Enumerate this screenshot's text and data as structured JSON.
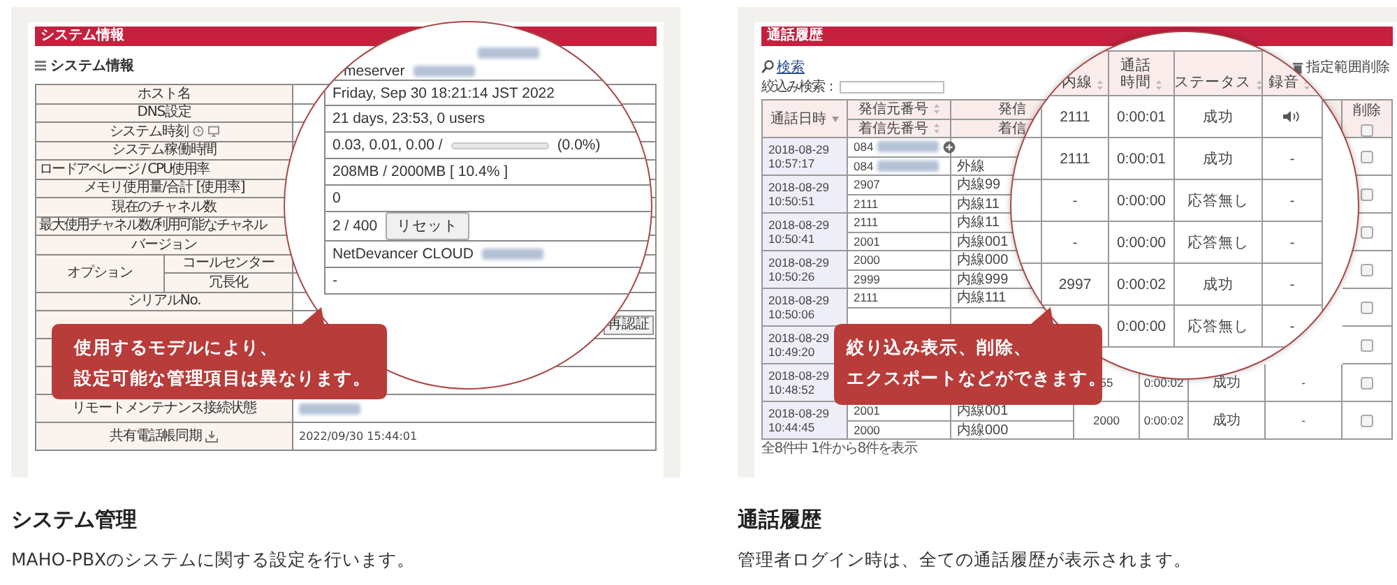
{
  "system_screenshot": {
    "header_bar": "システム情報",
    "subheading": "システム情報",
    "rows": [
      {
        "label": "ホスト名",
        "kind": "plain"
      },
      {
        "label": "DNS設定",
        "kind": "plain"
      },
      {
        "label": "システム時刻",
        "kind": "clock"
      },
      {
        "label": "システム稼働時間",
        "kind": "plain"
      },
      {
        "label": "ロードアベレージ / CPU使用率",
        "kind": "plain"
      },
      {
        "label": "メモリ使用量/合計 [使用率]",
        "kind": "plain"
      },
      {
        "label": "現在のチャネル数",
        "kind": "plain"
      },
      {
        "label": "最大使用チャネル数/利用可能なチャネル",
        "kind": "plain"
      },
      {
        "label": "バージョン",
        "kind": "plain"
      },
      {
        "label": "オプション",
        "kind": "option",
        "sublabels": [
          "コールセンター",
          "冗長化"
        ]
      },
      {
        "label": "シリアルNo.",
        "kind": "plain"
      }
    ],
    "lower_rows": [
      {
        "value": {
          "kind": "button",
          "text": "再認証"
        }
      },
      {},
      {},
      {
        "label": "リモートメンテナンス接続状態",
        "kind": "plain",
        "value": {
          "kind": "redacted"
        }
      },
      {
        "label": "共有電話帳同期",
        "kind": "sync",
        "value": {
          "kind": "text",
          "text": "2022/09/30 15:44:01"
        }
      }
    ],
    "magnifier": {
      "heading_rows": [
        [
          {
            "kind": "redacted"
          }
        ],
        [
          {
            "kind": "text",
            "text": "meserver"
          },
          {
            "kind": "redacted"
          }
        ]
      ],
      "rows": [
        [
          {
            "kind": "text",
            "text": "Friday, Sep 30 18:21:14 JST 2022"
          }
        ],
        [
          {
            "kind": "text",
            "text": "21 days, 23:53, 0 users"
          }
        ],
        [
          {
            "kind": "text",
            "text": "0.03, 0.01, 0.00 /"
          },
          {
            "kind": "meter",
            "level": 0
          },
          {
            "kind": "text",
            "text": "(0.0%)"
          }
        ],
        [
          {
            "kind": "text",
            "text": "208MB / 2000MB [ 10.4% ]"
          }
        ],
        [
          {
            "kind": "text",
            "text": "0"
          }
        ],
        [
          {
            "kind": "text",
            "text": "2 / 400"
          },
          {
            "kind": "button",
            "text": "リセット"
          }
        ],
        [
          {
            "kind": "text",
            "text": "NetDevancer CLOUD"
          },
          {
            "kind": "redacted"
          }
        ],
        [
          {
            "kind": "text",
            "text": "-"
          }
        ]
      ]
    },
    "callout": [
      "使用するモデルにより、",
      "設定可能な管理項目は異なります。"
    ]
  },
  "history_screenshot": {
    "header_bar": "通話履歴",
    "search_link": "検索",
    "filter_label": "絞込み検索：",
    "delete_range": "指定範囲削除",
    "headers": {
      "date": "通話日時",
      "from": "発信元番号",
      "to": "着信先番号",
      "column_3_top": "発信",
      "column_3_bottom": "着信",
      "delete": "削除",
      "delete_all_checked": false
    },
    "groups": [
      {
        "date": "2018-08-29",
        "time": "10:57:17",
        "checked": false,
        "lines": [
          {
            "number": "084",
            "redacted": true,
            "expandable": true
          },
          {
            "number": "084",
            "redacted": true,
            "expandable": false,
            "line": "外線"
          }
        ]
      },
      {
        "date": "2018-08-29",
        "time": "10:50:51",
        "checked": false,
        "lines": [
          {
            "number": "2907",
            "redacted": false,
            "expandable": false,
            "line": "内線99"
          },
          {
            "number": "2111",
            "redacted": false,
            "expandable": false,
            "line": "内線11"
          }
        ]
      },
      {
        "date": "2018-08-29",
        "time": "10:50:41",
        "checked": false,
        "lines": [
          {
            "number": "2111",
            "redacted": false,
            "expandable": false,
            "line": "内線11"
          },
          {
            "number": "2001",
            "redacted": false,
            "expandable": false,
            "line": "内線001"
          }
        ]
      },
      {
        "date": "2018-08-29",
        "time": "10:50:26",
        "checked": false,
        "lines": [
          {
            "number": "2000",
            "redacted": false,
            "expandable": false,
            "line": "内線000"
          },
          {
            "number": "2999",
            "redacted": false,
            "expandable": false,
            "line": "内線999"
          }
        ]
      },
      {
        "date": "2018-08-29",
        "time": "10:50:06",
        "checked": false,
        "lines": [
          {
            "number": "2111",
            "redacted": false,
            "expandable": false,
            "line": "内線111"
          }
        ]
      },
      {
        "date": "2018-08-29",
        "time": "10:49:20",
        "checked": false
      },
      {
        "date": "2018-08-29",
        "time": "10:48:52",
        "checked": false,
        "extension": "55",
        "duration": "0:00:02",
        "status": "成功",
        "recording": "-"
      },
      {
        "date": "2018-08-29",
        "time": "10:44:45",
        "checked": false,
        "lines": [
          {
            "number": "2001",
            "redacted": false,
            "expandable": false,
            "line": "内線001"
          },
          {
            "number": "2000",
            "redacted": false,
            "expandable": false,
            "line": "内線000"
          }
        ],
        "extension": "2000",
        "duration": "0:00:02",
        "status": "成功",
        "recording": "-"
      }
    ],
    "footer": "全8件中 1件から8件を表示",
    "magnifier": {
      "headers": [
        [
          "内線"
        ],
        [
          "通話",
          "時間"
        ],
        [
          "ステータス"
        ],
        [
          "録音"
        ]
      ],
      "rows": [
        {
          "extension": "2111",
          "duration": "0:00:01",
          "status": "成功",
          "recording": {
            "kind": "audio"
          }
        },
        {
          "extension": "2111",
          "duration": "0:00:01",
          "status": "成功",
          "recording": {
            "kind": "text",
            "text": "-"
          }
        },
        {
          "extension": "-",
          "duration": "0:00:00",
          "status": "応答無し",
          "recording": {
            "kind": "text",
            "text": "-"
          }
        },
        {
          "extension": "-",
          "duration": "0:00:00",
          "status": "応答無し",
          "recording": {
            "kind": "text",
            "text": "-"
          }
        },
        {
          "extension": "2997",
          "duration": "0:00:02",
          "status": "成功",
          "recording": {
            "kind": "text",
            "text": "-"
          }
        },
        {
          "duration": "0:00:00",
          "status": "応答無し",
          "recording": {
            "kind": "text",
            "text": "-"
          }
        }
      ]
    },
    "callout": [
      "絞り込み表示、削除、",
      "エクスポートなどができます。"
    ]
  },
  "features": [
    {
      "title": "システム管理",
      "description": "MAHO-PBXのシステムに関する設定を行います。"
    },
    {
      "title": "通話履歴",
      "description": "管理者ログイン時は、全ての通話履歴が表示されます。"
    }
  ]
}
